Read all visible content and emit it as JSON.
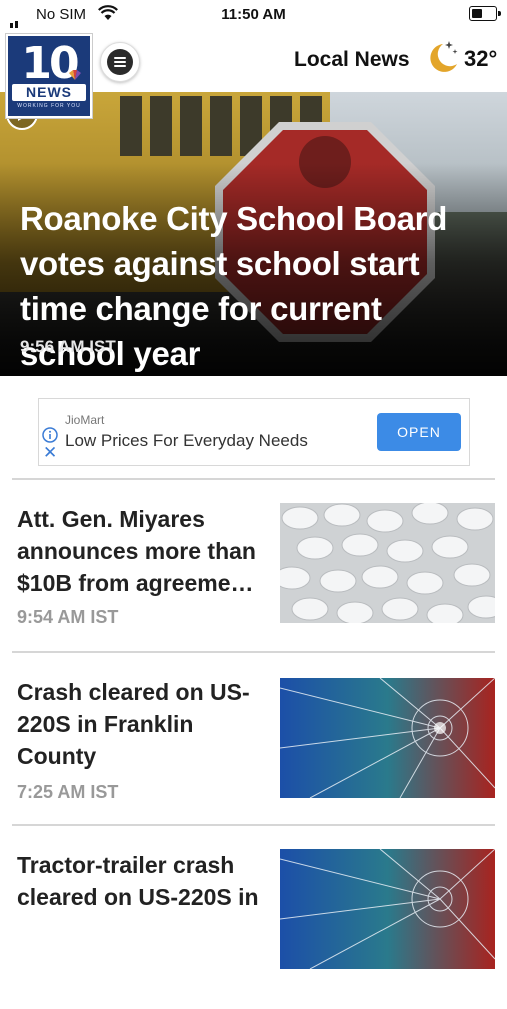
{
  "status_bar": {
    "carrier": "No SIM",
    "time": "11:50 AM"
  },
  "header": {
    "logo_number": "10",
    "logo_text": "NEWS",
    "logo_tagline": "WORKING FOR YOU",
    "section_title": "Local News",
    "temperature": "32°",
    "weather_icon": "moon-stars-icon",
    "menu_icon": "hamburger-icon"
  },
  "hero": {
    "headline": "Roanoke City School Board votes against school start time change for current school year",
    "timestamp": "9:56 AM IST",
    "play_icon": "play-icon"
  },
  "ad": {
    "brand": "JioMart",
    "tagline": "Low Prices For Everyday Needs",
    "cta": "OPEN",
    "accent": "#3c8be6"
  },
  "stories": [
    {
      "title": "Att. Gen. Miyares announces more than $10B from agreeme…",
      "time": "9:54 AM IST",
      "image": "pills"
    },
    {
      "title": "Crash cleared on US-220S in Franklin County",
      "time": "7:25 AM IST",
      "image": "broken-glass"
    },
    {
      "title": "Tractor-trailer crash cleared on US-220S in",
      "time": "",
      "image": "broken-glass"
    }
  ]
}
